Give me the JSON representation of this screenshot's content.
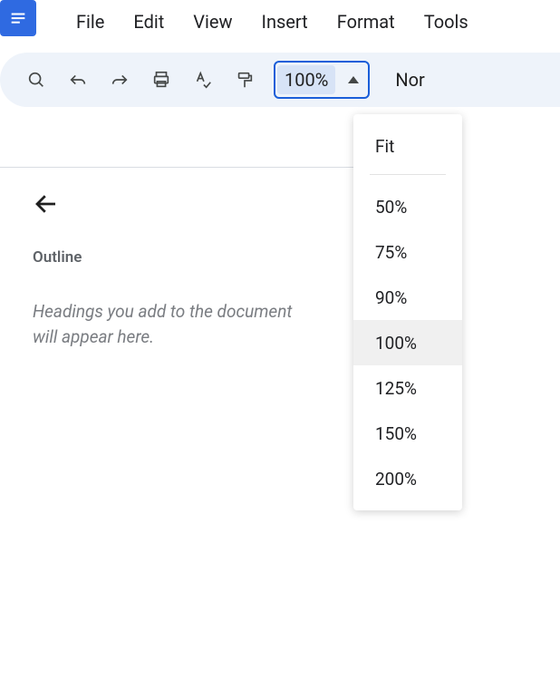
{
  "menubar": {
    "items": [
      "File",
      "Edit",
      "View",
      "Insert",
      "Format",
      "Tools"
    ]
  },
  "toolbar": {
    "zoom_value": "100%",
    "style_label": "Nor"
  },
  "zoom_dropdown": {
    "fit_label": "Fit",
    "options": [
      "50%",
      "75%",
      "90%",
      "100%",
      "125%",
      "150%",
      "200%"
    ],
    "hover_index": 3
  },
  "outline": {
    "title": "Outline",
    "placeholder": "Headings you add to the document will appear here."
  }
}
